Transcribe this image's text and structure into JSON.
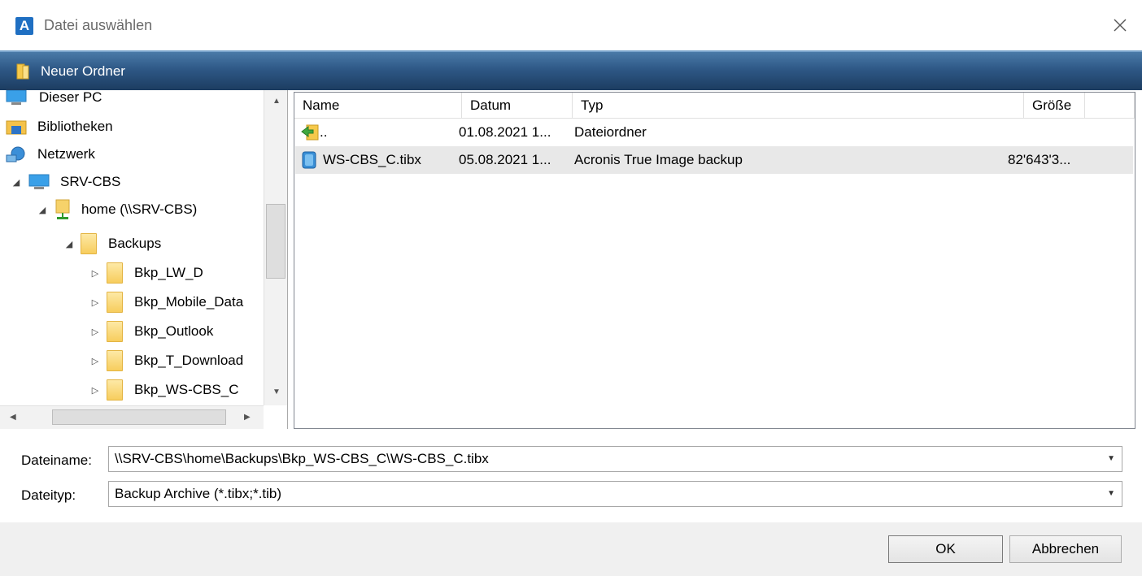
{
  "window": {
    "title": "Datei auswählen",
    "app_icon_letter": "A"
  },
  "toolbar": {
    "new_folder_label": "Neuer Ordner"
  },
  "tree": {
    "items": [
      {
        "label": "Dieser PC"
      },
      {
        "label": "Bibliotheken"
      },
      {
        "label": "Netzwerk"
      },
      {
        "label": "SRV-CBS"
      },
      {
        "label": "home (\\\\SRV-CBS)"
      },
      {
        "label": "Backups"
      },
      {
        "label": "Bkp_LW_D"
      },
      {
        "label": "Bkp_Mobile_Data"
      },
      {
        "label": "Bkp_Outlook"
      },
      {
        "label": "Bkp_T_Download"
      },
      {
        "label": "Bkp_WS-CBS_C"
      }
    ]
  },
  "list": {
    "headers": {
      "name": "Name",
      "date": "Datum",
      "type": "Typ",
      "size": "Größe"
    },
    "rows": [
      {
        "name": "..",
        "date": "01.08.2021 1...",
        "type": "Dateiordner",
        "size": ""
      },
      {
        "name": "WS-CBS_C.tibx",
        "date": "05.08.2021 1...",
        "type": "Acronis True Image backup",
        "size": "82'643'3..."
      }
    ]
  },
  "form": {
    "filename_label": "Dateiname:",
    "filename_value": "\\\\SRV-CBS\\home\\Backups\\Bkp_WS-CBS_C\\WS-CBS_C.tibx",
    "filetype_label": "Dateityp:",
    "filetype_value": "Backup Archive (*.tibx;*.tib)"
  },
  "buttons": {
    "ok": "OK",
    "cancel": "Abbrechen"
  },
  "colors": {
    "toolbar_dark": "#1c3c60",
    "toolbar_light": "#4a7aa8",
    "app_icon": "#1f6fc2",
    "folder": "#f7cd5d"
  }
}
